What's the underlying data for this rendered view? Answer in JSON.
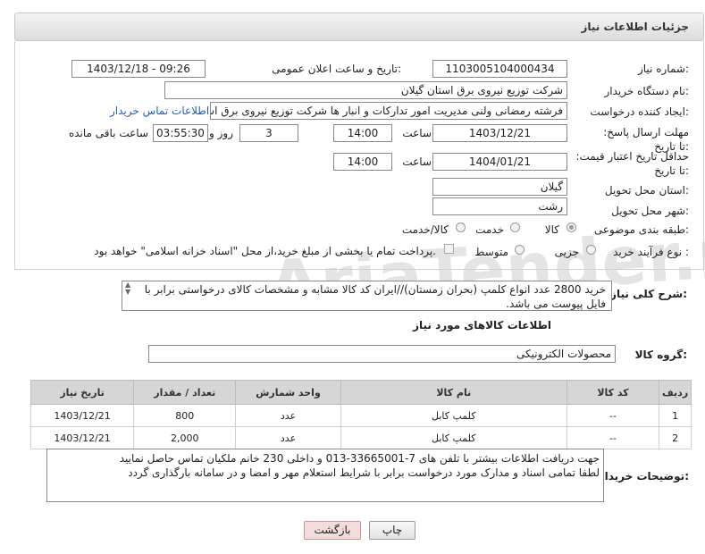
{
  "panel": {
    "title": "جزئیات اطلاعات نیاز"
  },
  "watermark": "AriaTender.neT",
  "labels": {
    "need_number": "شماره نیاز:",
    "announce_datetime": "تاریخ و ساعت اعلان عمومی:",
    "buyer_org": "نام دستگاه خریدار:",
    "requester": "ایجاد کننده درخواست:",
    "response_deadline": "مهلت ارسال پاسخ: تا تاریخ:",
    "time": "ساعت",
    "days_and": "روز و",
    "time_remaining": "ساعت باقی مانده",
    "price_validity": "حداقل تاریخ اعتبار قیمت: تا تاریخ:",
    "time2": "ساعت",
    "delivery_province": "استان محل تحویل:",
    "delivery_city": "شهر محل تحویل:",
    "category": "طبقه بندی موضوعی:",
    "purchase_process": "نوع فرآیند خرید :",
    "description": "شرح کلی نیاز:",
    "goods_info": "اطلاعات کالاهای مورد نیاز",
    "goods_group": "گروه کالا:",
    "buyer_notes": "توضیحات خریدار:"
  },
  "fields": {
    "need_number": "1103005104000434",
    "announce_datetime": "1403/12/18 - 09:26",
    "buyer_org": "شرکت توزیع نیروی برق استان گیلان",
    "requester": "فرشته رمضانی ولنی مدیریت امور تدارکات و انبار ها شرکت توزیع نیروی برق استان گیلان",
    "contact_link": "اطلاعات تماس خریدار",
    "response_date": "1403/12/21",
    "response_time": "14:00",
    "days": "3",
    "remaining": "03:55:30",
    "validity_date": "1404/01/21",
    "validity_time": "14:00",
    "province": "گیلان",
    "city": "رشت",
    "description": "خرید 2800 عدد انواع کلمپ (بحران زمستان)//ایران کد کالا مشابه و مشخصات کالای درخواستی برابر با فایل پیوست می باشد.",
    "goods_group": "محصولات الکترونیکی",
    "buyer_notes": "جهت دریافت اطلاعات بیشتر با تلفن های 7-33665001-013 و داخلی 230 خانم ملکیان تماس حاصل نمایید\nلطفا تمامی اسناد و مدارک مورد درخواست برابر با شرایط استعلام مهر و امضا و در سامانه بارگذاری گردد"
  },
  "category_options": [
    {
      "label": "کالا",
      "selected": true
    },
    {
      "label": "خدمت",
      "selected": false
    },
    {
      "label": "کالا/خدمت",
      "selected": false
    }
  ],
  "process_options": [
    {
      "label": "جزیی",
      "selected": false
    },
    {
      "label": "متوسط",
      "selected": false
    }
  ],
  "payment_note": "پرداخت تمام یا بخشی از مبلغ خرید،از محل \"اسناد خزانه اسلامی\" خواهد بود.",
  "table": {
    "headers": [
      "ردیف",
      "کد کالا",
      "نام کالا",
      "واحد شمارش",
      "تعداد / مقدار",
      "تاریخ نیاز"
    ],
    "rows": [
      [
        "1",
        "--",
        "کلمپ کابل",
        "عدد",
        "800",
        "1403/12/21"
      ],
      [
        "2",
        "--",
        "کلمپ کابل",
        "عدد",
        "2,000",
        "1403/12/21"
      ]
    ]
  },
  "buttons": {
    "print": "چاپ",
    "back": "بازگشت"
  }
}
